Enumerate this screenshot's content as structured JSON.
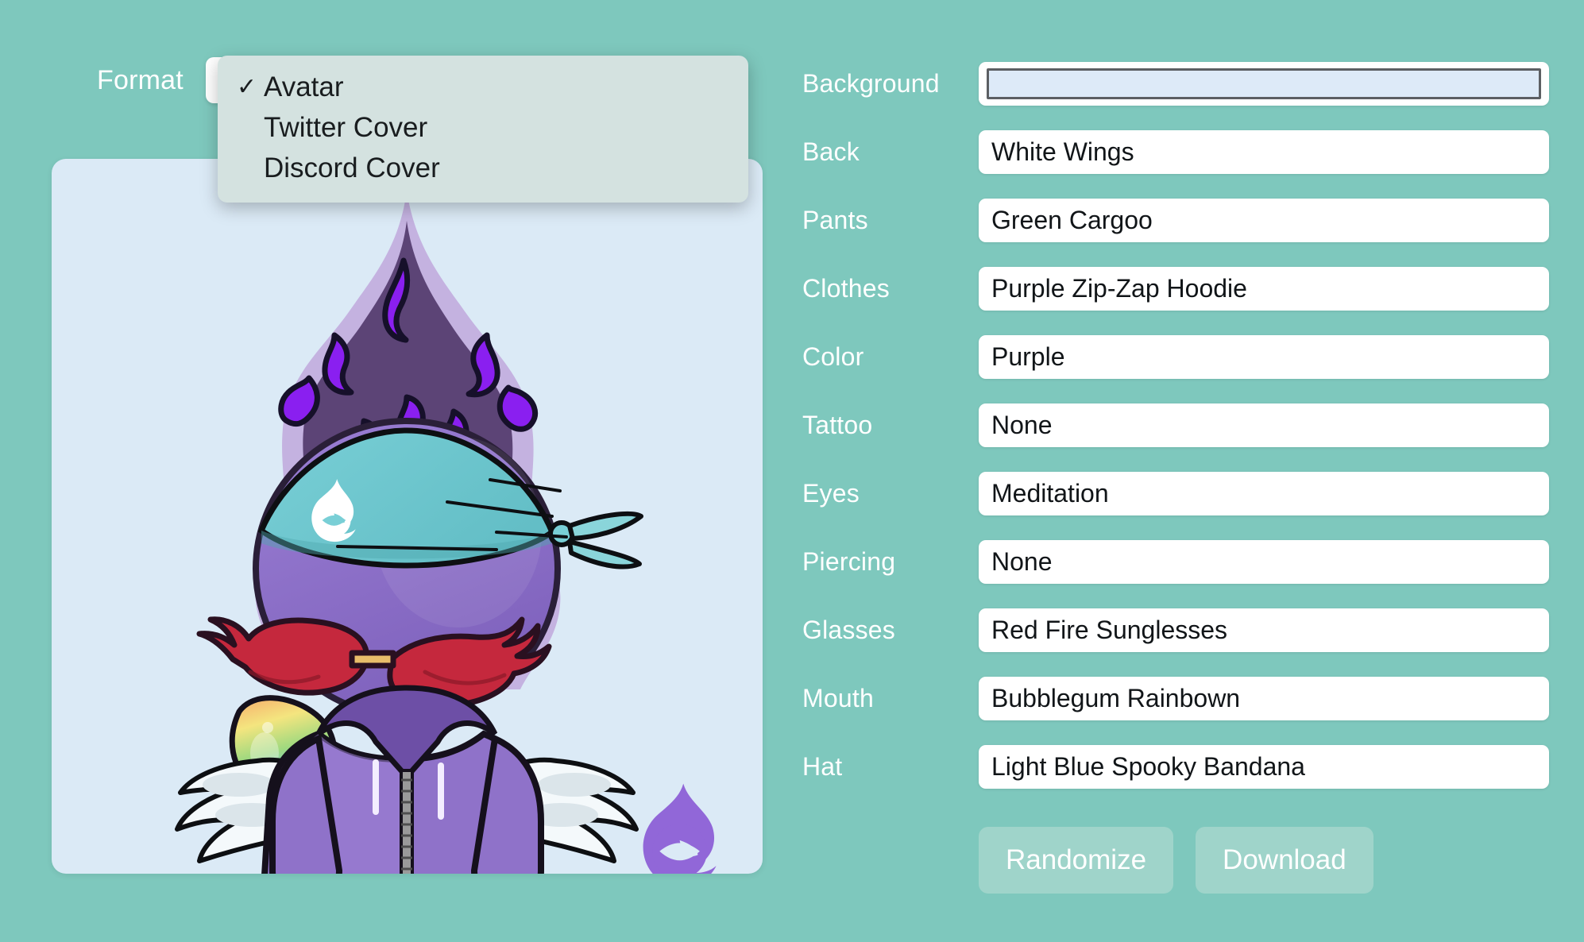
{
  "format": {
    "label": "Format",
    "selected": "Avatar",
    "options": [
      {
        "label": "Avatar",
        "checked": "✓"
      },
      {
        "label": "Twitter Cover",
        "checked": ""
      },
      {
        "label": "Discord Cover",
        "checked": ""
      }
    ]
  },
  "traits": [
    {
      "label": "Background",
      "value": "",
      "type": "color",
      "color": "#ddeaf8"
    },
    {
      "label": "Back",
      "value": "White Wings",
      "type": "text"
    },
    {
      "label": "Pants",
      "value": "Green Cargoo",
      "type": "text"
    },
    {
      "label": "Clothes",
      "value": "Purple Zip-Zap Hoodie",
      "type": "text"
    },
    {
      "label": "Color",
      "value": "Purple",
      "type": "text"
    },
    {
      "label": "Tattoo",
      "value": "None",
      "type": "text"
    },
    {
      "label": "Eyes",
      "value": "Meditation",
      "type": "text"
    },
    {
      "label": "Piercing",
      "value": "None",
      "type": "text"
    },
    {
      "label": "Glasses",
      "value": "Red Fire Sunglesses",
      "type": "text"
    },
    {
      "label": "Mouth",
      "value": "Bubblegum Rainbown",
      "type": "text"
    },
    {
      "label": "Hat",
      "value": "Light Blue Spooky Bandana",
      "type": "text"
    }
  ],
  "buttons": {
    "randomize": "Randomize",
    "download": "Download"
  },
  "colors": {
    "page_background": "#7ec8bd",
    "dropdown_panel": "#d4e2e0",
    "avatar_canvas": "#dbeaf6",
    "button": "#9fd4ca",
    "label_text": "#ffffff",
    "input_background": "#ffffff",
    "input_text": "#111518"
  },
  "avatar": {
    "watermark_icon": "flame-ghost-logo",
    "bandana_icon": "flame-ghost-logo"
  }
}
